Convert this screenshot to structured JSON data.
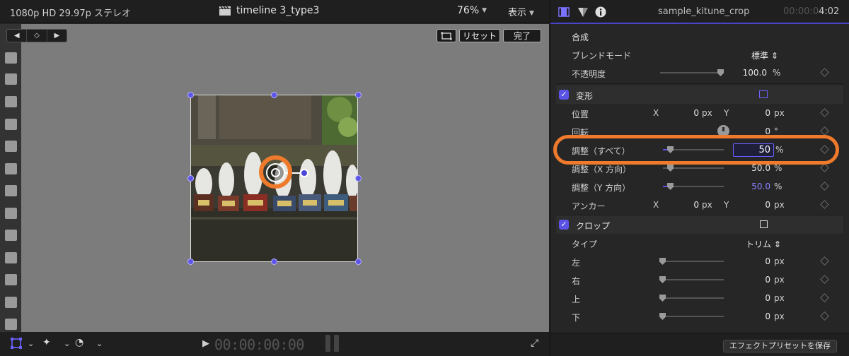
{
  "viewer": {
    "format": "1080p HD 29.97p ステレオ",
    "title": "timeline 3_type3",
    "zoom": "76%",
    "view_menu": "表示",
    "reset_label": "リセット",
    "done_label": "完了",
    "timecode": "00:00:00:00"
  },
  "inspector": {
    "clip_name": "sample_kitune_crop",
    "duration_dim": "00:00:0",
    "duration_main": "4:02",
    "compositing": {
      "title": "合成",
      "blend_mode_label": "ブレンドモード",
      "blend_mode_value": "標準",
      "opacity_label": "不透明度",
      "opacity_value": "100.0",
      "opacity_unit": "%",
      "opacity_level": 1.0
    },
    "transform": {
      "title": "変形",
      "position_label": "位置",
      "position_x": "0",
      "position_y": "0",
      "rotation_label": "回転",
      "rotation_value": "0",
      "rotation_unit": "°",
      "scale_all_label": "調整（すべて）",
      "scale_all_value": "50",
      "scale_x_label": "調整（X 方向）",
      "scale_x_value": "50.0",
      "scale_y_label": "調整（Y 方向）",
      "scale_y_value": "50.0",
      "anchor_label": "アンカー",
      "anchor_x": "0",
      "anchor_y": "0"
    },
    "crop": {
      "title": "クロップ",
      "type_label": "タイプ",
      "type_value": "トリム",
      "left_label": "左",
      "left_value": "0",
      "right_label": "右",
      "right_value": "0",
      "top_label": "上",
      "top_value": "0",
      "bottom_label": "下",
      "bottom_value": "0"
    },
    "units": {
      "px": "px",
      "percent": "%",
      "x": "X",
      "y": "Y"
    },
    "save_preset_label": "エフェクトプリセットを保存"
  },
  "colors": {
    "accent": "#5b53e6",
    "highlight": "#ef7a2c"
  }
}
